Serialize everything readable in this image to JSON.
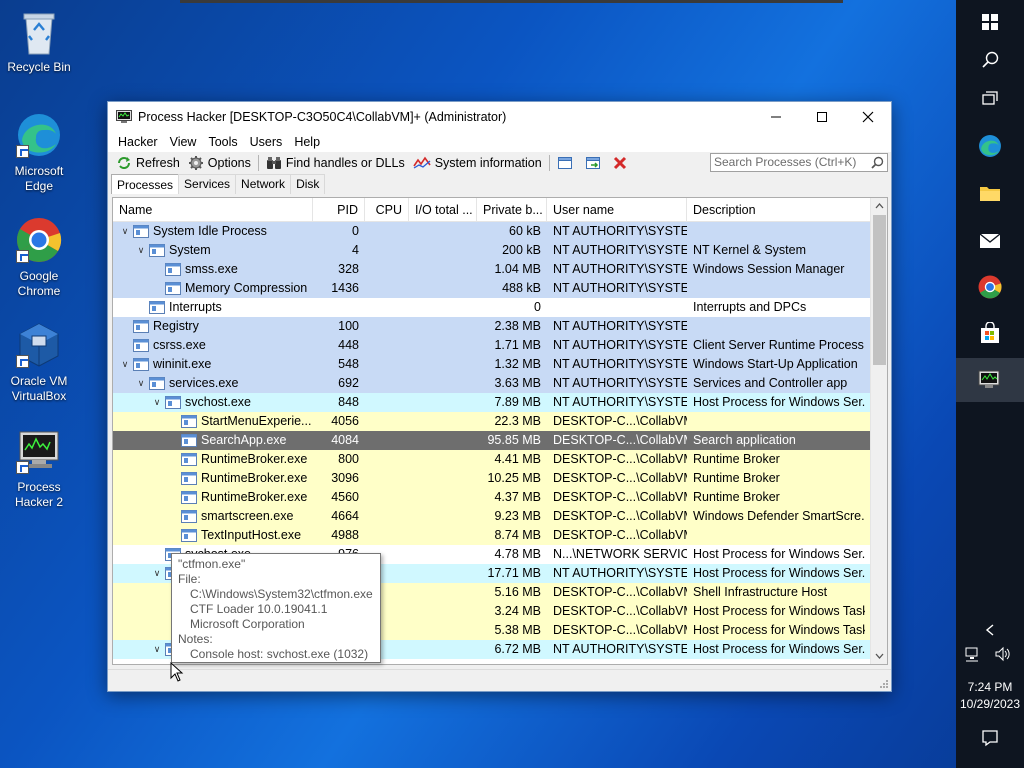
{
  "desktop": {
    "icons": [
      {
        "label": "Recycle Bin"
      },
      {
        "label": "Microsoft Edge"
      },
      {
        "label": "Google Chrome"
      },
      {
        "label": "Oracle VM VirtualBox"
      },
      {
        "label": "Process Hacker 2"
      }
    ]
  },
  "window": {
    "title": "Process Hacker [DESKTOP-C3O50C4\\CollabVM]+ (Administrator)",
    "menu": [
      "Hacker",
      "View",
      "Tools",
      "Users",
      "Help"
    ],
    "toolbar": {
      "refresh": "Refresh",
      "options": "Options",
      "find_handles": "Find handles or DLLs",
      "system_info": "System information",
      "search_placeholder": "Search Processes (Ctrl+K)"
    },
    "tabs": [
      "Processes",
      "Services",
      "Network",
      "Disk"
    ],
    "columns": [
      "Name",
      "PID",
      "CPU",
      "I/O total ...",
      "Private b...",
      "User name",
      "Description"
    ],
    "rows": [
      {
        "depth": 0,
        "tw": "v",
        "name": "System Idle Process",
        "pid": "0",
        "cpu": "",
        "io": "",
        "priv": "60 kB",
        "user": "NT AUTHORITY\\SYSTEM",
        "desc": "",
        "kind": "sys"
      },
      {
        "depth": 1,
        "tw": "v",
        "name": "System",
        "pid": "4",
        "cpu": "",
        "io": "",
        "priv": "200 kB",
        "user": "NT AUTHORITY\\SYSTEM",
        "desc": "NT Kernel & System",
        "kind": "sys"
      },
      {
        "depth": 2,
        "tw": "",
        "name": "smss.exe",
        "pid": "328",
        "cpu": "",
        "io": "",
        "priv": "1.04 MB",
        "user": "NT AUTHORITY\\SYSTEM",
        "desc": "Windows Session Manager",
        "kind": "sys"
      },
      {
        "depth": 2,
        "tw": "",
        "name": "Memory Compression",
        "pid": "1436",
        "cpu": "",
        "io": "",
        "priv": "488 kB",
        "user": "NT AUTHORITY\\SYSTEM",
        "desc": "",
        "kind": "sys"
      },
      {
        "depth": 1,
        "tw": "",
        "name": "Interrupts",
        "pid": "",
        "cpu": "",
        "io": "",
        "priv": "0",
        "user": "",
        "desc": "Interrupts and DPCs",
        "kind": "plain"
      },
      {
        "depth": 0,
        "tw": "",
        "name": "Registry",
        "pid": "100",
        "cpu": "",
        "io": "",
        "priv": "2.38 MB",
        "user": "NT AUTHORITY\\SYSTEM",
        "desc": "",
        "kind": "sys"
      },
      {
        "depth": 0,
        "tw": "",
        "name": "csrss.exe",
        "pid": "448",
        "cpu": "",
        "io": "",
        "priv": "1.71 MB",
        "user": "NT AUTHORITY\\SYSTEM",
        "desc": "Client Server Runtime Process",
        "kind": "sys"
      },
      {
        "depth": 0,
        "tw": "v",
        "name": "wininit.exe",
        "pid": "548",
        "cpu": "",
        "io": "",
        "priv": "1.32 MB",
        "user": "NT AUTHORITY\\SYSTEM",
        "desc": "Windows Start-Up Application",
        "kind": "sys"
      },
      {
        "depth": 1,
        "tw": "v",
        "name": "services.exe",
        "pid": "692",
        "cpu": "",
        "io": "",
        "priv": "3.63 MB",
        "user": "NT AUTHORITY\\SYSTEM",
        "desc": "Services and Controller app",
        "kind": "sys"
      },
      {
        "depth": 2,
        "tw": "v",
        "name": "svchost.exe",
        "pid": "848",
        "cpu": "",
        "io": "",
        "priv": "7.89 MB",
        "user": "NT AUTHORITY\\SYSTEM",
        "desc": "Host Process for Windows Ser...",
        "kind": "host"
      },
      {
        "depth": 3,
        "tw": "",
        "name": "StartMenuExperie...",
        "pid": "4056",
        "cpu": "",
        "io": "",
        "priv": "22.3 MB",
        "user": "DESKTOP-C...\\CollabVM",
        "desc": "",
        "kind": "user"
      },
      {
        "depth": 3,
        "tw": "",
        "name": "SearchApp.exe",
        "pid": "4084",
        "cpu": "",
        "io": "",
        "priv": "95.85 MB",
        "user": "DESKTOP-C...\\CollabVM",
        "desc": "Search application",
        "kind": "sel"
      },
      {
        "depth": 3,
        "tw": "",
        "name": "RuntimeBroker.exe",
        "pid": "800",
        "cpu": "",
        "io": "",
        "priv": "4.41 MB",
        "user": "DESKTOP-C...\\CollabVM",
        "desc": "Runtime Broker",
        "kind": "user"
      },
      {
        "depth": 3,
        "tw": "",
        "name": "RuntimeBroker.exe",
        "pid": "3096",
        "cpu": "",
        "io": "",
        "priv": "10.25 MB",
        "user": "DESKTOP-C...\\CollabVM",
        "desc": "Runtime Broker",
        "kind": "user"
      },
      {
        "depth": 3,
        "tw": "",
        "name": "RuntimeBroker.exe",
        "pid": "4560",
        "cpu": "",
        "io": "",
        "priv": "4.37 MB",
        "user": "DESKTOP-C...\\CollabVM",
        "desc": "Runtime Broker",
        "kind": "user"
      },
      {
        "depth": 3,
        "tw": "",
        "name": "smartscreen.exe",
        "pid": "4664",
        "cpu": "",
        "io": "",
        "priv": "9.23 MB",
        "user": "DESKTOP-C...\\CollabVM",
        "desc": "Windows Defender SmartScre...",
        "kind": "user"
      },
      {
        "depth": 3,
        "tw": "",
        "name": "TextInputHost.exe",
        "pid": "4988",
        "cpu": "",
        "io": "",
        "priv": "8.74 MB",
        "user": "DESKTOP-C...\\CollabVM",
        "desc": "",
        "kind": "user"
      },
      {
        "depth": 2,
        "tw": "",
        "name": "svchost.exe",
        "pid": "976",
        "cpu": "",
        "io": "",
        "priv": "4.78 MB",
        "user": "N...\\NETWORK SERVICE",
        "desc": "Host Process for Windows Ser...",
        "kind": "plain"
      },
      {
        "depth": 2,
        "tw": "v",
        "name": "",
        "pid": "",
        "cpu": "",
        "io": "",
        "priv": "17.71 MB",
        "user": "NT AUTHORITY\\SYSTEM",
        "desc": "Host Process for Windows Ser...",
        "kind": "host"
      },
      {
        "depth": 3,
        "tw": "",
        "name": "",
        "pid": "",
        "cpu": "",
        "io": "",
        "priv": "5.16 MB",
        "user": "DESKTOP-C...\\CollabVM",
        "desc": "Shell Infrastructure Host",
        "kind": "user"
      },
      {
        "depth": 3,
        "tw": "",
        "name": "",
        "pid": "",
        "cpu": "",
        "io": "",
        "priv": "3.24 MB",
        "user": "DESKTOP-C...\\CollabVM",
        "desc": "Host Process for Windows Tasks",
        "kind": "user"
      },
      {
        "depth": 3,
        "tw": "",
        "name": "",
        "pid": "",
        "cpu": "",
        "io": "",
        "priv": "5.38 MB",
        "user": "DESKTOP-C...\\CollabVM",
        "desc": "Host Process for Windows Tasks",
        "kind": "user"
      },
      {
        "depth": 2,
        "tw": "v",
        "name": "",
        "pid": "",
        "cpu": "",
        "io": "",
        "priv": "6.72 MB",
        "user": "NT AUTHORITY\\SYSTEM",
        "desc": "Host Process for Windows Ser...",
        "kind": "host"
      }
    ]
  },
  "tooltip": {
    "title": "\"ctfmon.exe\"",
    "file_label": "File:",
    "file_path": "C:\\Windows\\System32\\ctfmon.exe",
    "file_desc": "CTF Loader 10.0.19041.1",
    "company": "Microsoft Corporation",
    "notes_label": "Notes:",
    "notes": "Console host: svchost.exe (1032)"
  },
  "taskbar": {
    "time": "7:24 PM",
    "date": "10/29/2023"
  },
  "colors": {
    "service_row": "#c8daf5",
    "user_row": "#ffffc8",
    "host_row": "#d0f8ff",
    "selected_row": "#6e6e6e"
  }
}
